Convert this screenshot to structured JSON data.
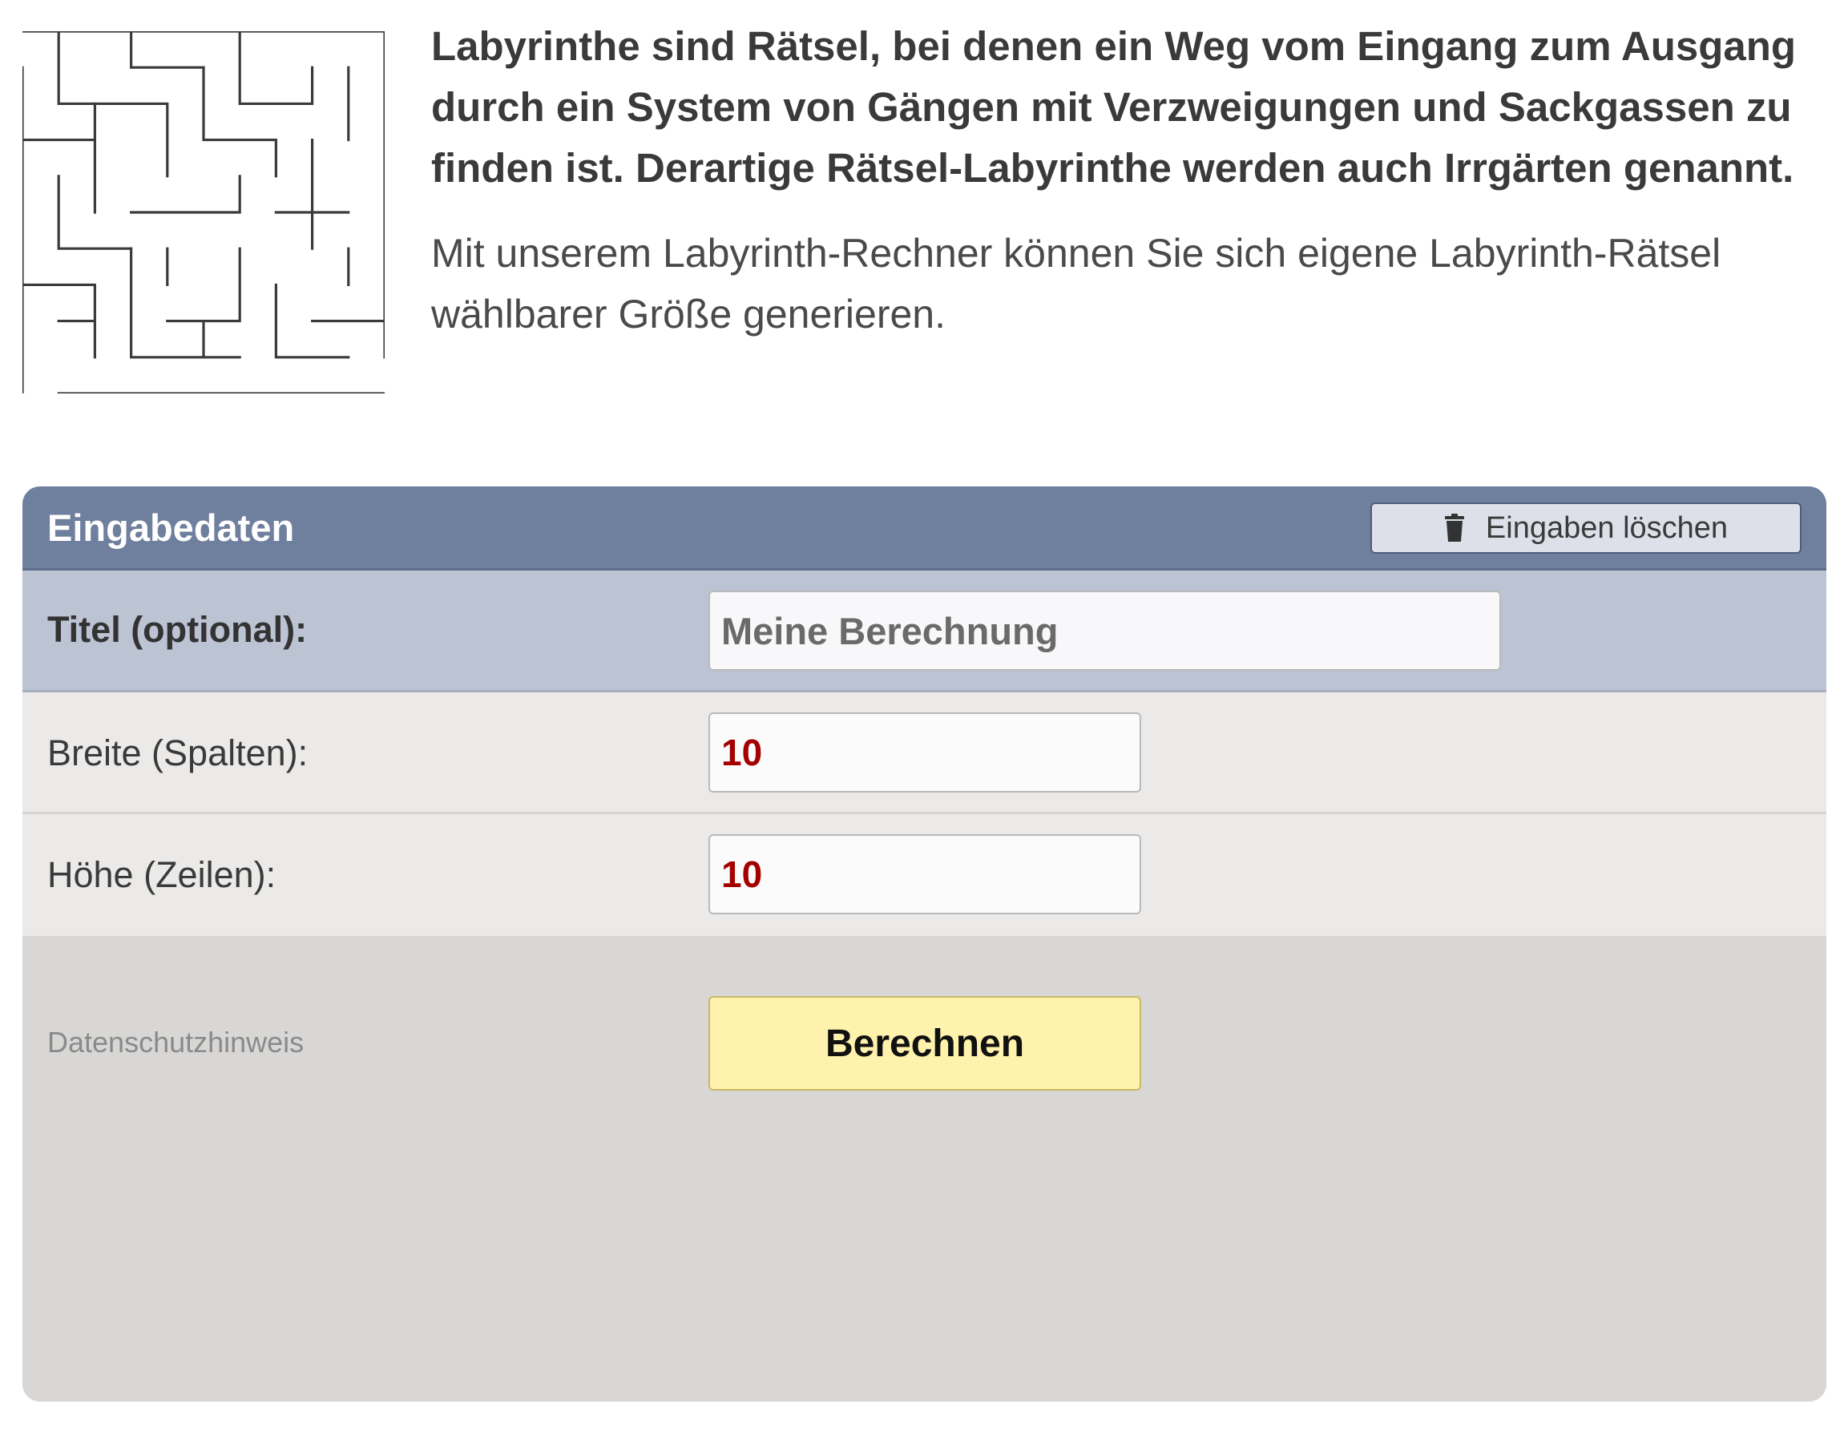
{
  "intro": {
    "lead": "Labyrinthe sind Rätsel, bei denen ein Weg vom Eingang zum Ausgang durch ein System von Gängen mit Verzweigungen und Sackgassen zu finden ist. Derartige Rätsel-Labyrinthe werden auch Irrgärten genannt.",
    "description": "Mit unserem Labyrinth-Rechner können Sie sich eigene Labyrinth-Rätsel wählbarer Größe generieren."
  },
  "panel": {
    "title": "Eingabedaten",
    "clear_button": "Eingaben löschen",
    "clear_icon": "trash-icon",
    "header_color": "#6f7f9e"
  },
  "fields": {
    "title": {
      "label": "Titel (optional):",
      "placeholder": "Meine Berechnung",
      "value": ""
    },
    "width": {
      "label": "Breite (Spalten):",
      "value": "10"
    },
    "height": {
      "label": "Höhe (Zeilen):",
      "value": "10"
    }
  },
  "footer": {
    "privacy_link": "Datenschutzhinweis",
    "submit_button": "Berechnen",
    "submit_color": "#fff2ac"
  }
}
